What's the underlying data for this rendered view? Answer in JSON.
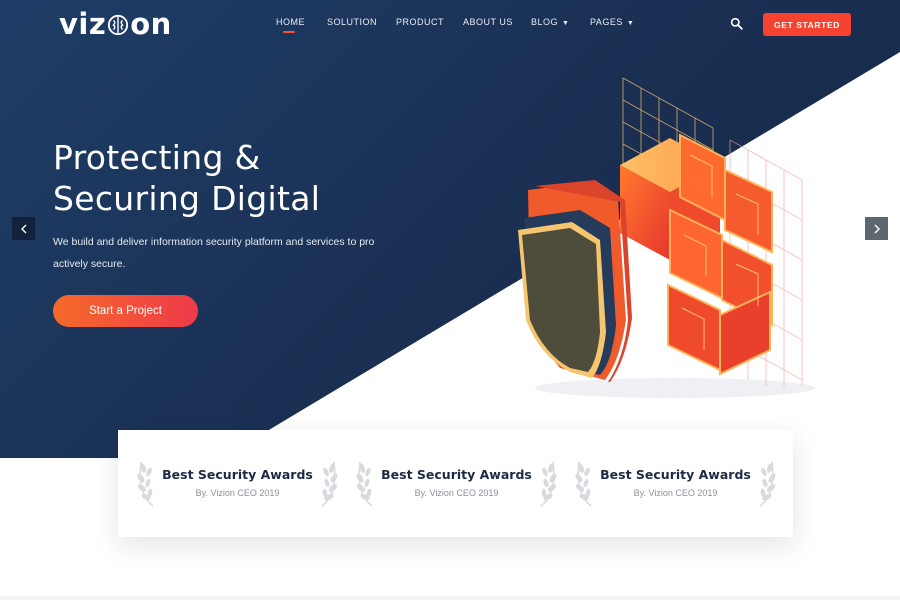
{
  "brand": {
    "logo_text_a": "viz",
    "logo_text_b": "on"
  },
  "nav": {
    "items": [
      {
        "label": "HOME",
        "active": true
      },
      {
        "label": "SOLUTION"
      },
      {
        "label": "PRODUCT"
      },
      {
        "label": "ABOUT US"
      },
      {
        "label": "BLOG",
        "dropdown": true
      },
      {
        "label": "PAGES",
        "dropdown": true
      }
    ],
    "search_icon": "search-icon",
    "cta_label": "GET STARTED"
  },
  "hero": {
    "title_line1": "Protecting &",
    "title_line2": "Securing Digital",
    "desc_line1": "We build and deliver information security platform and services to pro",
    "desc_line2": "actively secure.",
    "button_label": "Start a Project",
    "prev_icon": "chevron-left-icon",
    "next_icon": "chevron-right-icon"
  },
  "awards": [
    {
      "title": "Best Security Awards",
      "subtitle": "By. Vizion CEO 2019"
    },
    {
      "title": "Best Security Awards",
      "subtitle": "By. Vizion CEO 2019"
    },
    {
      "title": "Best Security Awards",
      "subtitle": "By. Vizion CEO 2019"
    }
  ],
  "colors": {
    "hero_navy": "#1e3d66",
    "accent_orange": "#f5432f",
    "gradient_start": "#f56a2a",
    "gradient_end": "#ee3a4a"
  }
}
